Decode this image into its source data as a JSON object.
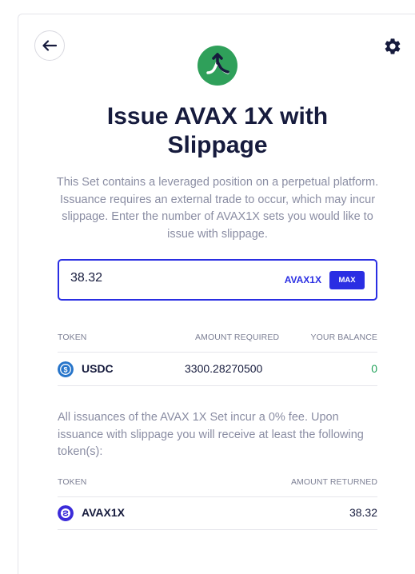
{
  "header": {
    "title": "Issue AVAX 1X with Slippage",
    "description": "This Set contains a leveraged position on a perpetual platform. Issuance requires an external trade to occur, which may incur slippage. Enter the number of AVAX1X sets you would like to issue with slippage."
  },
  "input": {
    "value": "38.32",
    "unit": "AVAX1X",
    "max_label": "MAX"
  },
  "required_table": {
    "headers": {
      "token": "TOKEN",
      "amount": "AMOUNT REQUIRED",
      "balance": "YOUR BALANCE"
    },
    "rows": [
      {
        "token": "USDC",
        "amount": "3300.28270500",
        "balance": "0",
        "icon": "usdc-icon"
      }
    ]
  },
  "fee_note": "All issuances of the AVAX 1X Set incur a 0% fee. Upon issuance with slippage you will receive at least the following token(s):",
  "returned_table": {
    "headers": {
      "token": "TOKEN",
      "amount": "AMOUNT RETURNED"
    },
    "rows": [
      {
        "token": "AVAX1X",
        "amount": "38.32",
        "icon": "avax1x-icon"
      }
    ]
  },
  "colors": {
    "accent": "#2a2ee3",
    "logo_green": "#2fa05a",
    "balance_green": "#22a35a",
    "muted_text": "#8a8da3",
    "heading": "#161b3d"
  },
  "icons": {
    "back": "arrow-left-icon",
    "settings": "gear-icon",
    "logo": "index-logo-icon"
  }
}
